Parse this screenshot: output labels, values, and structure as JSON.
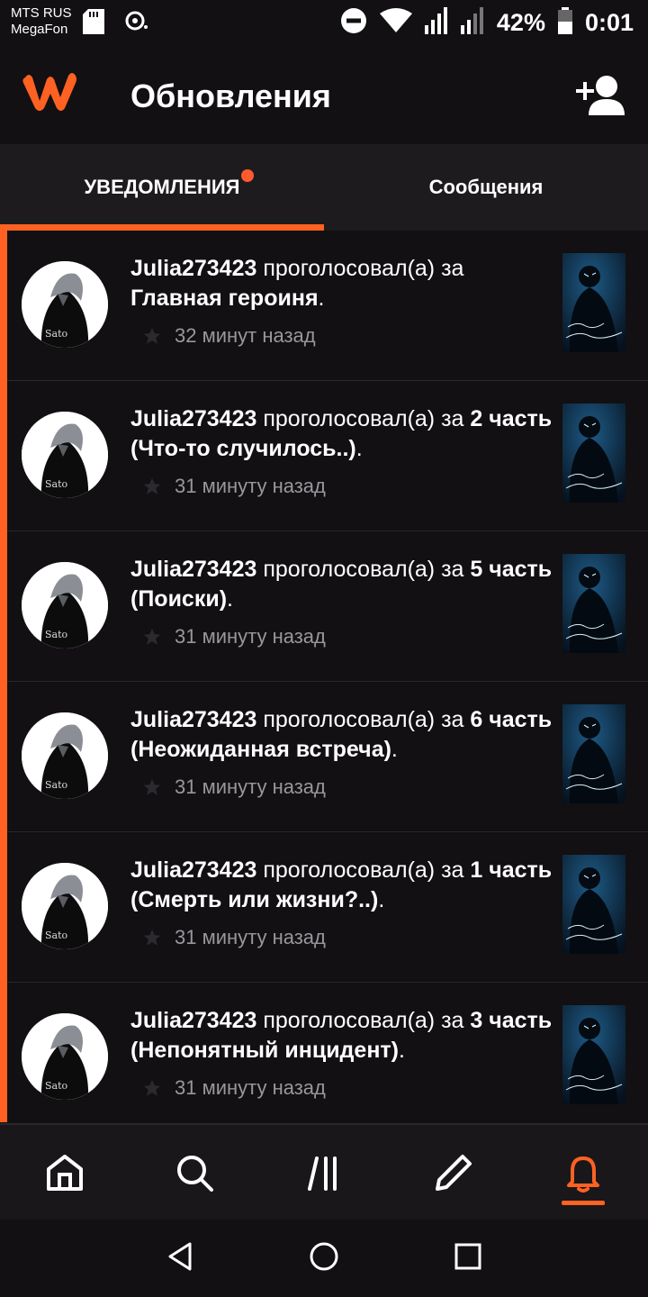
{
  "status_bar": {
    "carrier_line1": "MTS RUS",
    "carrier_line2": "MegaFon",
    "battery": "42%",
    "time": "0:01",
    "icons": [
      "sd-card-icon",
      "sync-icon",
      "dnd-icon",
      "wifi-icon",
      "signal-icon",
      "signal-icon",
      "battery-icon"
    ]
  },
  "header": {
    "title": "Обновления",
    "logo": "wattpad-logo",
    "add_friend_icon": "add-user-icon"
  },
  "tabs": [
    {
      "label": "УВЕДОМЛЕНИЯ",
      "active": true,
      "has_dot": true
    },
    {
      "label": "Сообщения",
      "active": false,
      "has_dot": false
    }
  ],
  "notifications": [
    {
      "user": "Julia273423",
      "action": " проголосовал(а) за ",
      "story": "Главная героиня",
      "end": ".",
      "time": "32 минут назад"
    },
    {
      "user": "Julia273423",
      "action": " проголосовал(а) за ",
      "story": "2 часть (Что-то случилось..)",
      "end": ".",
      "time": "31 минуту назад"
    },
    {
      "user": "Julia273423",
      "action": " проголосовал(а) за ",
      "story": "5 часть (Поиски)",
      "end": ".",
      "time": "31 минуту назад"
    },
    {
      "user": "Julia273423",
      "action": " проголосовал(а) за ",
      "story": "6 часть (Неожиданная встреча)",
      "end": ".",
      "time": "31 минуту назад"
    },
    {
      "user": "Julia273423",
      "action": " проголосовал(а) за ",
      "story": "1 часть (Смерть или жизни?..)",
      "end": ".",
      "time": "31 минуту назад"
    },
    {
      "user": "Julia273423",
      "action": " проголосовал(а) за ",
      "story": "3 часть (Непонятный инцидент)",
      "end": ".",
      "time": "31 минуту назад"
    }
  ],
  "bottom_nav": [
    {
      "name": "home-icon",
      "active": false
    },
    {
      "name": "search-icon",
      "active": false
    },
    {
      "name": "library-icon",
      "active": false
    },
    {
      "name": "write-icon",
      "active": false
    },
    {
      "name": "notifications-icon",
      "active": true
    }
  ],
  "colors": {
    "accent": "#ff6122",
    "background": "#121013",
    "muted_text": "#9a979c"
  }
}
